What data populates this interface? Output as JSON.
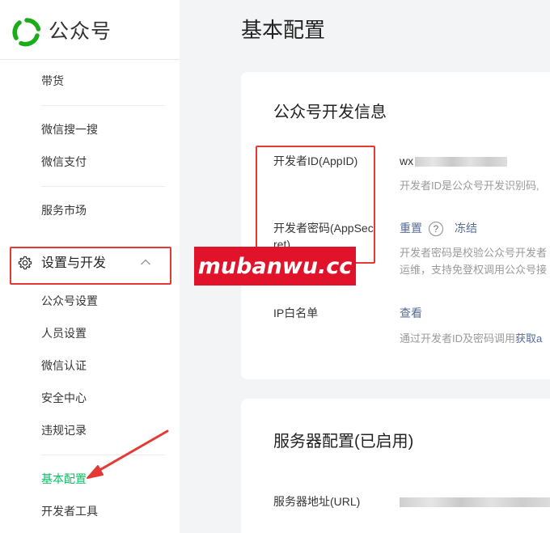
{
  "sidebar": {
    "logo_text": "公众号",
    "items": [
      {
        "label": "带货"
      },
      {
        "label": "微信搜一搜"
      },
      {
        "label": "微信支付"
      },
      {
        "label": "服务市场"
      }
    ],
    "group": {
      "label": "设置与开发",
      "expanded": true
    },
    "sub_items": [
      {
        "label": "公众号设置"
      },
      {
        "label": "人员设置"
      },
      {
        "label": "微信认证"
      },
      {
        "label": "安全中心"
      },
      {
        "label": "违规记录"
      },
      {
        "label": "基本配置",
        "active": true
      },
      {
        "label": "开发者工具"
      }
    ],
    "active_color": "#07c160"
  },
  "main": {
    "title": "基本配置",
    "dev_info": {
      "title": "公众号开发信息",
      "appid_label": "开发者ID(AppID)",
      "appid_value_prefix": "wx",
      "appid_desc": "开发者ID是公众号开发识别码,",
      "secret_label": "开发者密码(AppSecret)",
      "reset_label": "重置",
      "help_icon": "?",
      "freeze_label": "冻结",
      "secret_desc_1": "开发者密码是校验公众号开发者",
      "secret_desc_2": "运维，支持免登权调用公众号接",
      "ip_label": "IP白名单",
      "ip_view_label": "查看",
      "ip_desc_prefix": "通过开发者ID及密码调用",
      "ip_desc_link": "获取a"
    },
    "server_config": {
      "title": "服务器配置(已启用)",
      "url_label": "服务器地址(URL)"
    }
  },
  "watermark": {
    "text": "mubanwu.cc"
  },
  "colors": {
    "highlight": "#e53935",
    "watermark_bg": "#e0132a",
    "link": "#576b95"
  }
}
